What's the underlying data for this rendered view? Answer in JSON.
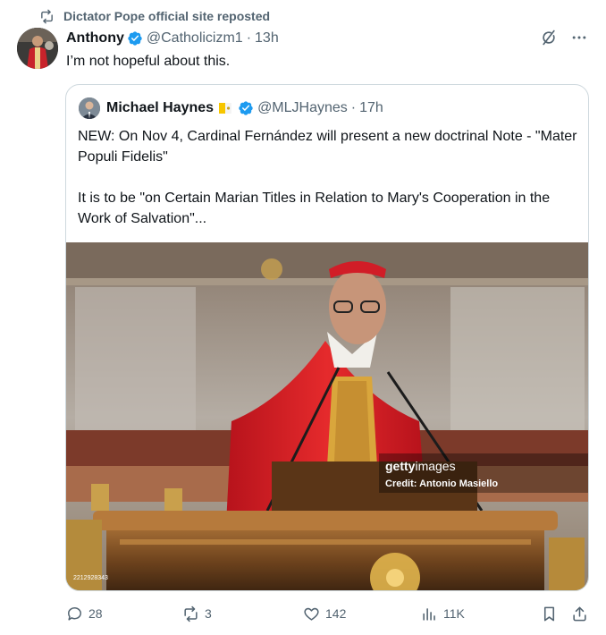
{
  "repost": {
    "text": "Dictator Pope official site reposted"
  },
  "tweet": {
    "name": "Anthony",
    "handle": "@Catholicizm1",
    "separator": "·",
    "time": "13h",
    "text": "I’m not hopeful about this."
  },
  "quote": {
    "name": "Michael Haynes",
    "handle": "@MLJHaynes",
    "separator": "·",
    "time": "17h",
    "paragraph1": "NEW: On Nov 4, Cardinal Fernández will present a new doctrinal Note - \"Mater Populi Fidelis\"",
    "paragraph2": "It is to be \"on Certain Marian Titles in Relation to Mary's Cooperation in the Work of Salvation\"...",
    "image": {
      "logo_bold": "getty",
      "logo_regular": "images",
      "credit": "Credit: Antonio Masiello",
      "id": "2212928343"
    }
  },
  "actions": {
    "replies": "28",
    "reposts": "3",
    "likes": "142",
    "views": "11K"
  },
  "colors": {
    "verified": "#1d9bf0",
    "muted": "#536471",
    "border": "#cfd9de",
    "repost_green": "#536471"
  },
  "icons": [
    "repost-icon",
    "verified-badge-icon",
    "grok-icon",
    "more-icon",
    "reply-icon",
    "retweet-icon",
    "like-icon",
    "views-icon",
    "bookmark-icon",
    "share-icon"
  ]
}
